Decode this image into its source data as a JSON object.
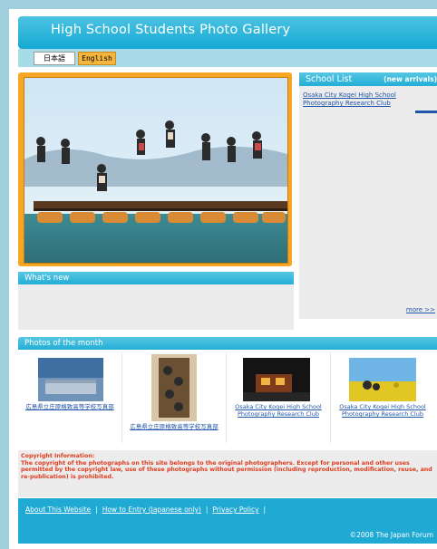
{
  "header": {
    "title": "High School Students Photo Gallery"
  },
  "language": {
    "japanese": "日本語",
    "english": "English"
  },
  "school_list": {
    "title": "School List",
    "new_arrivals": "(new arrivals)",
    "items": [
      "Osaka City Kogei High School Photography Research Club"
    ],
    "more": "more >>"
  },
  "whats_new": {
    "title": "What's new"
  },
  "photos_of_month": {
    "title": "Photos of the month",
    "items": [
      {
        "caption": "広島県立庄原格致高等学校写真部"
      },
      {
        "caption": "広島県立庄原格致高等学校写真部"
      },
      {
        "caption": "Osaka City Kogei High School Photography Research Club"
      },
      {
        "caption": "Osaka City Kogei High School Photography Research Club"
      }
    ]
  },
  "copyright": {
    "heading": "Copyright Information:",
    "body": "The copyright of the photographs on this site belongs to the original photographers. Except for personal and other uses permitted by the copyright law, use of these photographs without permission (including reproduction, modification, reuse, and re-publication) is prohibited."
  },
  "footer": {
    "links": [
      "About This Website",
      "How to Entry (Japanese only)",
      "Privacy Policy"
    ],
    "copyright": "©2008 The Japan Forum"
  },
  "colors": {
    "accent": "#1fa9d3",
    "frame": "#f7a623",
    "warning": "#e13b1d"
  }
}
